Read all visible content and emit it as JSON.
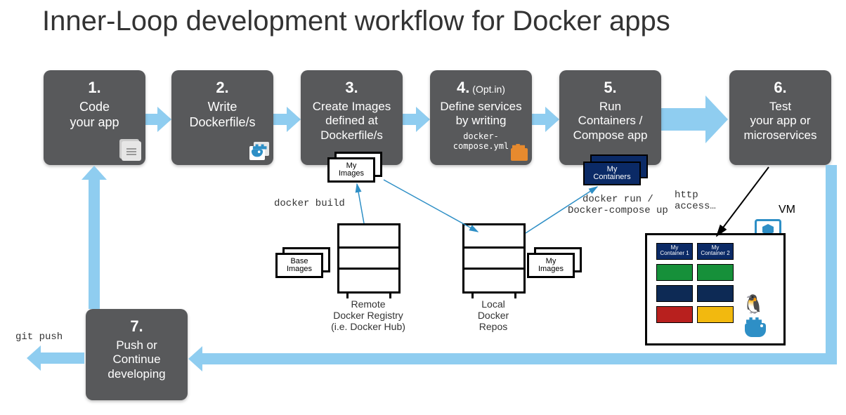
{
  "title": "Inner-Loop development workflow for Docker apps",
  "steps": [
    {
      "num": "1.",
      "opt": "",
      "body": "Code\nyour app"
    },
    {
      "num": "2.",
      "opt": "",
      "body": "Write\nDockerfile/s"
    },
    {
      "num": "3.",
      "opt": "",
      "body": "Create Images\ndefined at\nDockerfile/s"
    },
    {
      "num": "4.",
      "opt": " (Opt.in)",
      "body": "Define services\nby writing",
      "small": "docker-compose.yml"
    },
    {
      "num": "5.",
      "opt": "",
      "body": "Run\nContainers /\nCompose app"
    },
    {
      "num": "6.",
      "opt": "",
      "body": "Test\nyour app or\nmicroservices"
    },
    {
      "num": "7.",
      "opt": "",
      "body": "Push or\nContinue\ndeveloping"
    }
  ],
  "labels": {
    "docker_build": "docker build",
    "docker_run": "docker run /\nDocker-compose up",
    "http_access": "http\naccess…",
    "vm": "VM",
    "git_push": "git push",
    "remote_registry": "Remote\nDocker Registry\n(i.e. Docker Hub)",
    "local_repos": "Local\nDocker\nRepos"
  },
  "stacks": {
    "my_images": "My\nImages",
    "base_images": "Base\nImages",
    "my_containers": "My\nContainers"
  },
  "vm_containers": {
    "c1": "My\nContainer 1",
    "c2": "My\nContainer 2"
  }
}
